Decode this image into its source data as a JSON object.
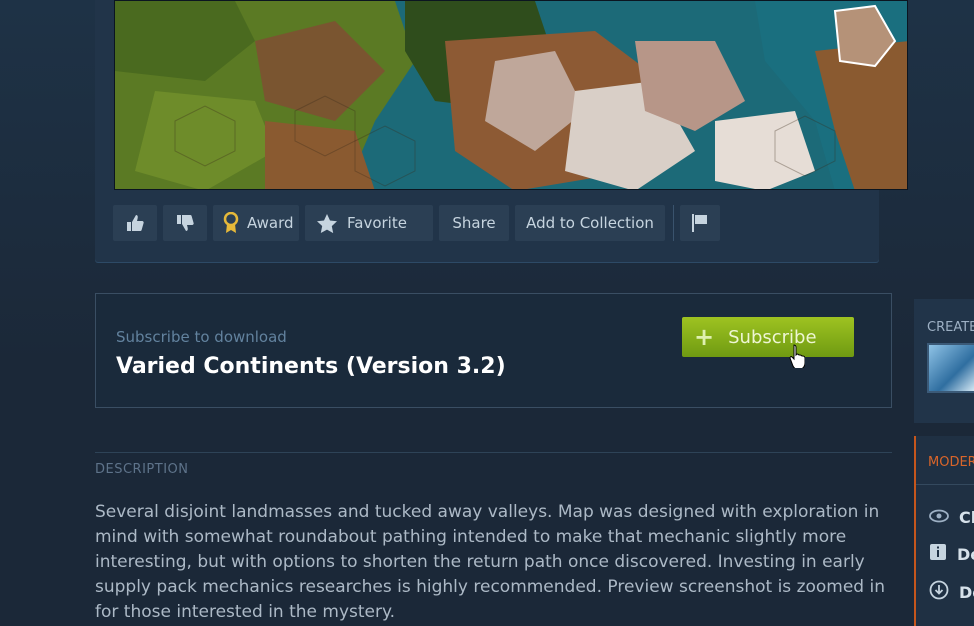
{
  "actions": {
    "award_label": "Award",
    "favorite_label": "Favorite",
    "share_label": "Share",
    "collection_label": "Add to Collection"
  },
  "subscribe": {
    "prompt": "Subscribe to download",
    "title": "Varied Continents (Version 3.2)",
    "button_label": "Subscribe"
  },
  "description": {
    "heading": "DESCRIPTION",
    "text": "Several disjoint landmasses and tucked away valleys. Map was designed with exploration in mind with somewhat roundabout pathing intended to make that mechanic slightly more interesting, but with options to shorten the return path once discovered. Investing in early supply pack mechanics researches is highly recommended. Preview screenshot is zoomed in for those interested in the mystery."
  },
  "sidebar": {
    "creator_label": "CREATE",
    "moderation_label": "MODER",
    "rows": [
      {
        "icon": "eye-icon",
        "label": "Cl"
      },
      {
        "icon": "info-icon",
        "label": "De"
      },
      {
        "icon": "download-icon",
        "label": "Do"
      }
    ]
  },
  "colors": {
    "background": "#1b2838",
    "subscribe_green": "#8db81c",
    "moderation_orange": "#d9652a"
  }
}
